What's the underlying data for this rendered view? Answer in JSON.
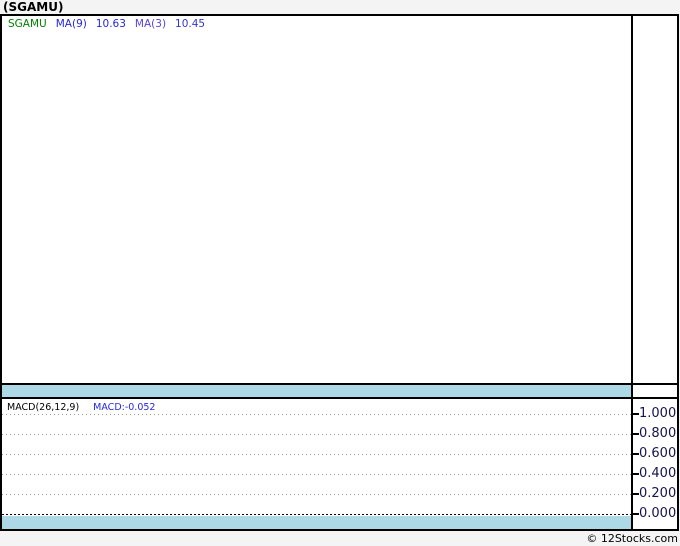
{
  "page": {
    "title": "(SGAMU)",
    "footer_credit": "© 12Stocks.com"
  },
  "main_chart": {
    "legend": {
      "symbol": "SGAMU",
      "ma9_label": "MA(9)",
      "ma9_value": "10.63",
      "ma3_label": "MA(3)",
      "ma3_value": "10.45"
    }
  },
  "macd_panel": {
    "indicator_label": "MACD(26,12,9)",
    "indicator_value": "MACD:-0.052",
    "axis_ticks": [
      "1.000",
      "0.800",
      "0.600",
      "0.400",
      "0.200",
      "0.000"
    ]
  },
  "colors": {
    "highlight_band": "#ADD8E6",
    "symbol_green": "#008000",
    "ma9_blue": "#2626DF",
    "ma3_purple": "#5B3FD6",
    "ma3_value_blue": "#3434CF",
    "macd_value_blue": "#2626DF",
    "axis_label_navy": "#14144E",
    "page_background": "#F4F4F4",
    "border_black": "#000000"
  },
  "chart_data": [
    {
      "type": "line",
      "title": "(SGAMU)",
      "series": [
        {
          "name": "SGAMU",
          "color": "#008000",
          "values": []
        },
        {
          "name": "MA(9)",
          "color": "#2626DF",
          "current": 10.63,
          "values": []
        },
        {
          "name": "MA(3)",
          "color": "#5B3FD6",
          "current": 10.45,
          "values": []
        }
      ],
      "legend_position": "top-left",
      "grid": false,
      "note": "price pane is rendered empty; only legend values are visible"
    },
    {
      "type": "line",
      "title": "MACD(26,12,9)",
      "series": [
        {
          "name": "MACD",
          "current": -0.052,
          "values": []
        }
      ],
      "ylim": [
        0.0,
        1.0
      ],
      "yticks": [
        1.0,
        0.8,
        0.6,
        0.4,
        0.2,
        0.0
      ],
      "grid": true,
      "legend_position": "top-left",
      "note": "indicator pane is rendered empty; dotted gridlines with emphasized zero line"
    }
  ]
}
